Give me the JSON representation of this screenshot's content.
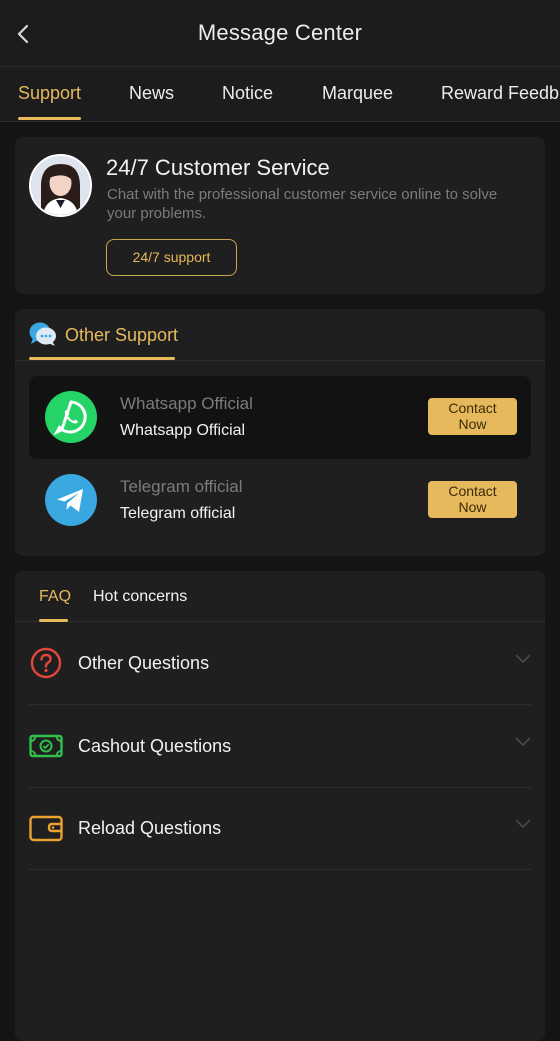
{
  "header": {
    "title": "Message Center"
  },
  "tabs": [
    {
      "label": "Support",
      "active": true
    },
    {
      "label": "News",
      "active": false
    },
    {
      "label": "Notice",
      "active": false
    },
    {
      "label": "Marquee",
      "active": false
    },
    {
      "label": "Reward Feedb",
      "active": false
    }
  ],
  "customer_service": {
    "title": "24/7 Customer Service",
    "description": "Chat with the professional customer service online to solve your problems.",
    "button_label": "24/7 support"
  },
  "other_support": {
    "title": "Other Support",
    "contacts": [
      {
        "name_grey": "Whatsapp Official",
        "name": "Whatsapp Official",
        "button_line1": "Contact",
        "button_line2": "Now",
        "icon": "whatsapp-icon"
      },
      {
        "name_grey": "Telegram official",
        "name": "Telegram official",
        "button_line1": "Contact",
        "button_line2": "Now",
        "icon": "telegram-icon"
      }
    ]
  },
  "faq": {
    "tabs": [
      {
        "label": "FAQ",
        "active": true
      },
      {
        "label": "Hot concerns",
        "active": false
      }
    ],
    "items": [
      {
        "label": "Other Questions",
        "icon": "question-circle-icon"
      },
      {
        "label": "Cashout Questions",
        "icon": "cash-icon"
      },
      {
        "label": "Reload Questions",
        "icon": "wallet-icon"
      }
    ]
  },
  "colors": {
    "accent": "#e5b95c",
    "background": "#141414",
    "card": "#1f1f1f",
    "whatsapp": "#25d366",
    "telegram": "#3aa8e0"
  }
}
